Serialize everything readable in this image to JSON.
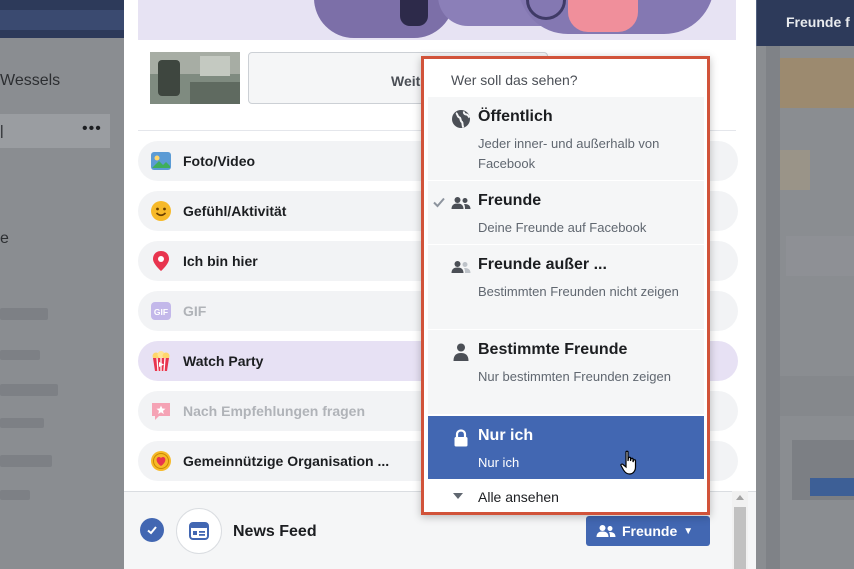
{
  "background": {
    "left_name": "Wessels",
    "left_row_pipe": "|",
    "left_row_more": "•••",
    "left_fragment": "e",
    "right_nav": "Freunde f"
  },
  "composer": {
    "preview_button_label": "Weit",
    "options": [
      {
        "label": "Foto/Video",
        "icon": "photo-icon"
      },
      {
        "label": "Gefühl/Aktivität",
        "icon": "smiley-icon"
      },
      {
        "label": "Ich bin hier",
        "icon": "location-pin-icon"
      },
      {
        "label": "GIF",
        "icon": "gif-icon"
      },
      {
        "label": "Watch Party",
        "icon": "popcorn-icon"
      },
      {
        "label": "Nach Empfehlungen fragen",
        "icon": "star-bubble-icon"
      },
      {
        "label": "Gemeinnützige Organisation ...",
        "icon": "donation-heart-icon"
      }
    ],
    "footer": {
      "destination": "News Feed",
      "audience_button": "Freunde"
    }
  },
  "audience_menu": {
    "header": "Wer soll das sehen?",
    "items": [
      {
        "title": "Öffentlich",
        "subtitle": "Jeder inner- und außerhalb von Facebook",
        "icon": "globe-icon",
        "checked": false,
        "selected": false
      },
      {
        "title": "Freunde",
        "subtitle": "Deine Freunde auf Facebook",
        "icon": "friends-icon",
        "checked": true,
        "selected": false
      },
      {
        "title": "Freunde außer ...",
        "subtitle": "Bestimmten Freunden nicht zeigen",
        "icon": "friends-except-icon",
        "checked": false,
        "selected": false
      },
      {
        "title": "Bestimmte Freunde",
        "subtitle": "Nur bestimmten Freunden zeigen",
        "icon": "person-icon",
        "checked": false,
        "selected": false
      },
      {
        "title": "Nur ich",
        "subtitle": "Nur ich",
        "icon": "lock-icon",
        "checked": false,
        "selected": true
      }
    ],
    "see_all": "Alle ansehen"
  },
  "colors": {
    "facebook_blue": "#4267b2",
    "dropdown_highlight_border": "#d1533a",
    "option_highlight": "#e7e1f4"
  }
}
